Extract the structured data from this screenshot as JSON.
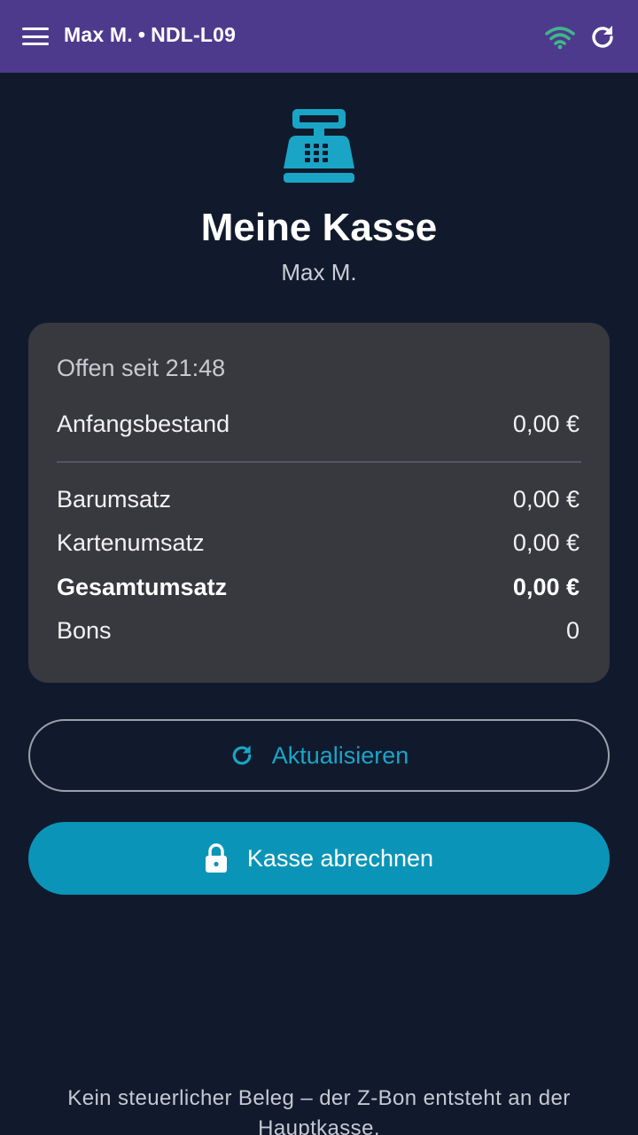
{
  "appbar": {
    "user": "Max M.",
    "separator": "•",
    "register_id": "NDL-L09",
    "wifi_icon": "wifi-icon",
    "refresh_icon": "refresh-icon",
    "colors": {
      "background": "#4e3a8c",
      "wifi": "#3fb68b"
    }
  },
  "header": {
    "icon": "cash-register-icon",
    "title": "Meine Kasse",
    "subtitle": "Max M."
  },
  "summary": {
    "open_since": "Offen seit 21:48",
    "opening_balance": {
      "label": "Anfangsbestand",
      "value": "0,00 €"
    },
    "rows": [
      {
        "label": "Barumsatz",
        "value": "0,00 €"
      },
      {
        "label": "Kartenumsatz",
        "value": "0,00 €"
      },
      {
        "label": "Gesamtumsatz",
        "value": "0,00 €"
      },
      {
        "label": "Bons",
        "value": "0"
      }
    ]
  },
  "actions": {
    "refresh_label": "Aktualisieren",
    "close_label": "Kasse abrechnen",
    "colors": {
      "accent": "#0a95b8"
    }
  },
  "footer": {
    "note": "Kein steuerlicher Beleg – der Z-Bon entsteht an der Hauptkasse."
  }
}
